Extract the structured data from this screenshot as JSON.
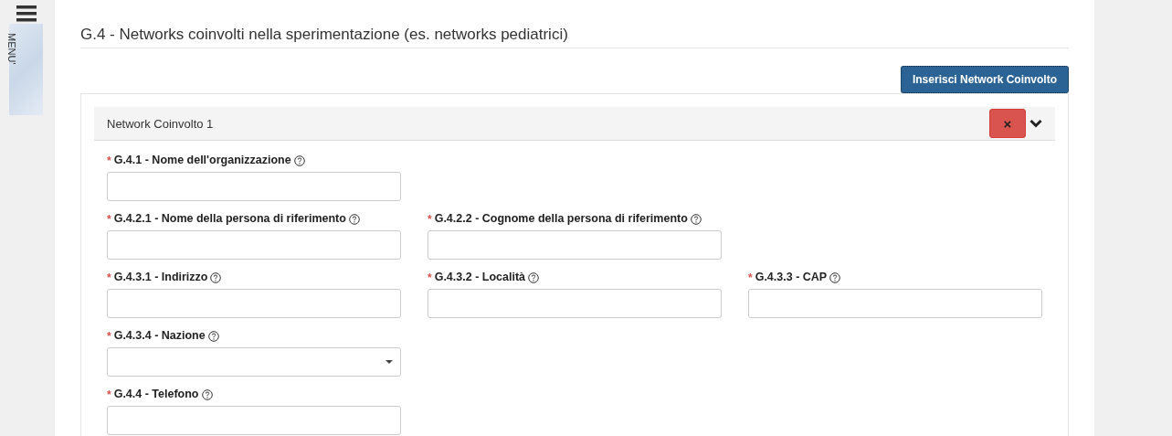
{
  "sidebar": {
    "menu_label": "MENU'"
  },
  "section": {
    "title": "G.4 - Networks coinvolti nella sperimentazione (es. networks pediatrici)",
    "add_button": "Inserisci Network Coinvolto"
  },
  "card": {
    "title": "Network Coinvolto 1",
    "expanded": true,
    "remove_button": "×",
    "required_mark": "*",
    "rows": [
      [
        {
          "kind": "text",
          "required": true,
          "label": "G.4.1 - Nome dell'organizzazione"
        }
      ],
      [
        {
          "kind": "text",
          "required": true,
          "label": "G.4.2.1 - Nome della persona di riferimento"
        },
        {
          "kind": "text",
          "required": true,
          "label": "G.4.2.2 - Cognome della persona di riferimento"
        }
      ],
      [
        {
          "kind": "text",
          "required": true,
          "label": "G.4.3.1 - Indirizzo"
        },
        {
          "kind": "text",
          "required": true,
          "label": "G.4.3.2 - Località"
        },
        {
          "kind": "text",
          "required": true,
          "label": "G.4.3.3 - CAP"
        }
      ],
      [
        {
          "kind": "select",
          "required": true,
          "label": "G.4.3.4 - Nazione"
        }
      ],
      [
        {
          "kind": "text",
          "required": true,
          "label": "G.4.4 - Telefono"
        }
      ]
    ]
  }
}
